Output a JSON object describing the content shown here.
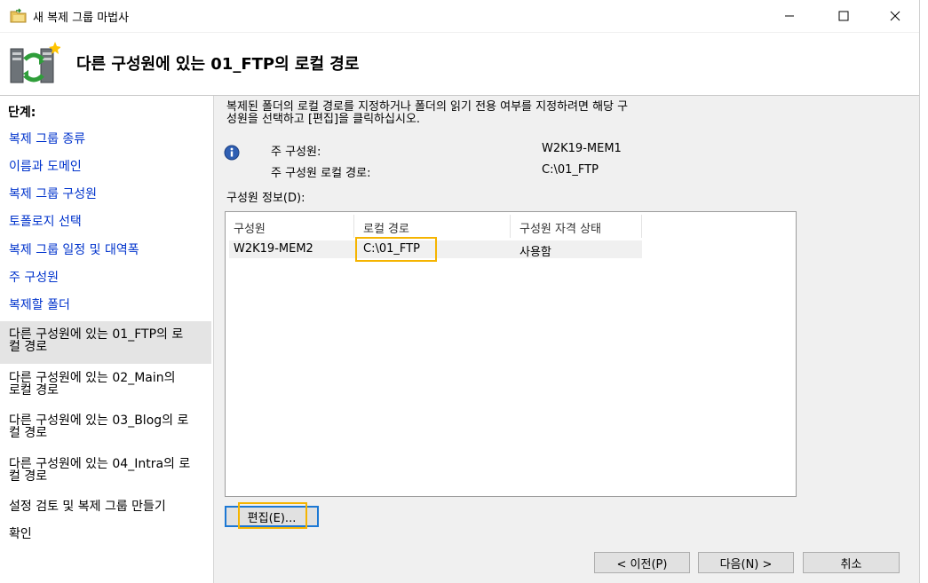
{
  "window": {
    "title": "새 복제 그룹 마법사",
    "page_heading": "다른 구성원에 있는 01_FTP의 로컬 경로"
  },
  "sidebar": {
    "heading": "단계:",
    "steps": [
      {
        "label": "복제 그룹 종류",
        "state": "link"
      },
      {
        "label": "이름과 도메인",
        "state": "link"
      },
      {
        "label": "복제 그룹 구성원",
        "state": "link"
      },
      {
        "label": "토폴로지 선택",
        "state": "link"
      },
      {
        "label": "복제 그룹 일정 및 대역폭",
        "state": "link"
      },
      {
        "label": "주 구성원",
        "state": "link"
      },
      {
        "label": "복제할 폴더",
        "state": "link"
      },
      {
        "label_line1": "다른 구성원에 있는 01_FTP의 로",
        "label_line2": "컬 경로",
        "state": "current"
      },
      {
        "label_line1": "다른 구성원에 있는 02_Main의",
        "label_line2": "로컬 경로",
        "state": "plain"
      },
      {
        "label_line1": "다른 구성원에 있는 03_Blog의 로",
        "label_line2": "컬 경로",
        "state": "plain"
      },
      {
        "label_line1": "다른 구성원에 있는 04_Intra의 로",
        "label_line2": "컬 경로",
        "state": "plain"
      },
      {
        "label": "설정 검토 및 복제 그룹 만들기",
        "state": "plain"
      },
      {
        "label": "확인",
        "state": "plain"
      }
    ]
  },
  "main": {
    "description_line1": "복제된 폴더의 로컬 경로를 지정하거나 폴더의 읽기 전용 여부를 지정하려면 해당 구",
    "description_line2": "성원을 선택하고 [편집]을 클릭하십시오.",
    "primary_member_label": "주 구성원:",
    "primary_member_value": "W2K19-MEM1",
    "primary_path_label": "주 구성원 로컬 경로:",
    "primary_path_value": "C:\\01_FTP",
    "member_info_label": "구성원 정보(D):",
    "table": {
      "columns": [
        "구성원",
        "로컬 경로",
        "구성원 자격 상태"
      ],
      "rows": [
        [
          "W2K19-MEM2",
          "C:\\01_FTP",
          "사용함"
        ]
      ]
    },
    "edit_button": "편집(E)..."
  },
  "footer": {
    "back_button": "< 이전(P)",
    "next_button": "다음(N) >",
    "cancel_button": "취소"
  },
  "colors": {
    "link": "#0033cc",
    "highlight_box": "#f5b400",
    "focus_border": "#1c78d4"
  }
}
